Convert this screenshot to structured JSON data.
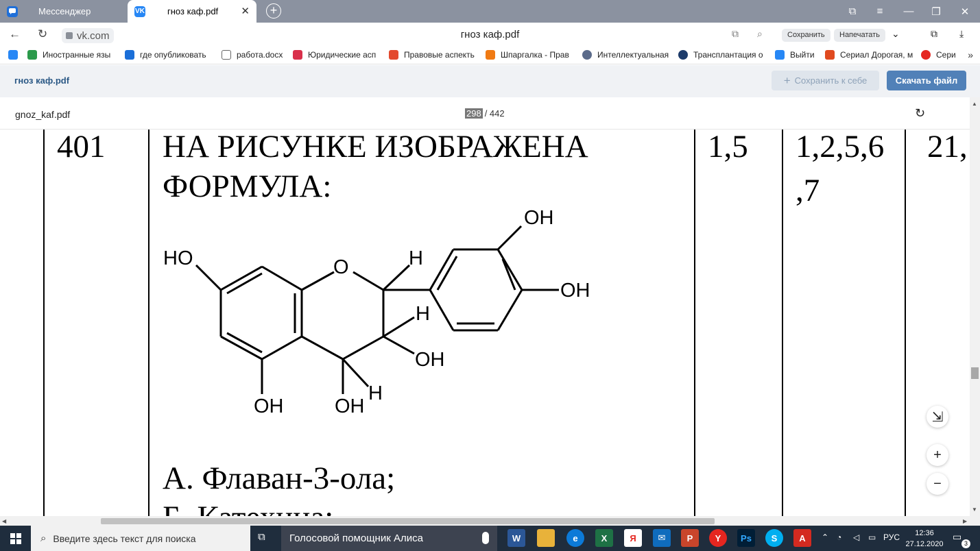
{
  "tabs": [
    {
      "label": "Мессенджер",
      "icon": "chat-icon"
    },
    {
      "label": "гноз каф.pdf",
      "icon": "vk-icon",
      "close": "✕"
    }
  ],
  "address": {
    "domain": "vk.com",
    "page_title": "гноз каф.pdf",
    "save_label": "Сохранить",
    "print_label": "Напечатать"
  },
  "bookmarks": [
    {
      "label": "Иностранные язы",
      "color": "#2787f5"
    },
    {
      "label": "где опубликовать",
      "color": "#1b6fd8"
    },
    {
      "label": "работа.docx",
      "color": "#ffffff"
    },
    {
      "label": "Юридические асп",
      "color": "#d9304b"
    },
    {
      "label": "Правовые аспекть",
      "color": "#e34a2e"
    },
    {
      "label": "Шпаргалка - Прав",
      "color": "#f07a13"
    },
    {
      "label": "Интеллектуальная",
      "color": "#5b6b8a"
    },
    {
      "label": "Трансплантация о",
      "color": "#1d3b6a"
    },
    {
      "label": "Выйти",
      "color": "#2787f5"
    },
    {
      "label": "Сериал Дорогая, м",
      "color": "#e04a1f"
    },
    {
      "label": "Сери",
      "color": "#e52620"
    }
  ],
  "vk": {
    "title": "гноз каф.pdf",
    "save_own": "Сохранить к себе",
    "download": "Скачать файл"
  },
  "pdf": {
    "filename": "gnoz_kaf.pdf",
    "page_current": "298",
    "page_total": "/ 442"
  },
  "page_content": {
    "num": "401",
    "q_line1": "НА РИСУНКЕ ИЗОБРАЖЕНА",
    "q_line2": "ФОРМУЛА:",
    "col3": "1,5",
    "col4_line1": "1,2,5,6",
    "col4_line2": ",7",
    "col5": "21,",
    "answer_a": "А. Флаван-3-ола;",
    "answer_b_partial": "Б. Катехина;"
  },
  "molecule_labels": {
    "ho": "HO",
    "o": "O",
    "h1": "H",
    "oh_top": "OH",
    "oh_right": "OH",
    "h2": "H",
    "oh_mid": "OH",
    "oh_bottom_left": "OH",
    "oh_bottom_mid": "OH",
    "h3": "H"
  },
  "zoom": {
    "fit": "⇲",
    "plus": "+",
    "minus": "−"
  },
  "taskbar": {
    "search_placeholder": "Введите здесь текст для поиска",
    "alice": "Голосовой помощник Алиса",
    "lang": "РУС",
    "time": "12:36",
    "date": "27.12.2020",
    "notifications": "3"
  }
}
